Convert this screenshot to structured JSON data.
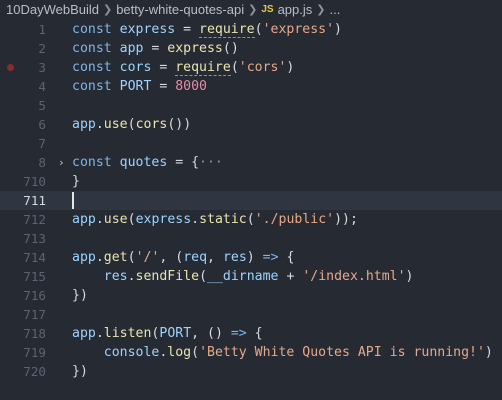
{
  "breadcrumb": {
    "items": [
      "10DayWebBuild",
      "betty-white-quotes-api"
    ],
    "file_icon": "JS",
    "file_name": "app.js",
    "trailing": "..."
  },
  "code_lines": [
    {
      "num": "1",
      "tokens": [
        [
          "kw",
          "const "
        ],
        [
          "id",
          "express"
        ],
        [
          "pn",
          " = "
        ],
        [
          "fn",
          "require"
        ],
        [
          "pn",
          "("
        ],
        [
          "str",
          "'express'"
        ],
        [
          "pn",
          ")"
        ]
      ]
    },
    {
      "num": "2",
      "tokens": [
        [
          "kw",
          "const "
        ],
        [
          "id",
          "app"
        ],
        [
          "pn",
          " = "
        ],
        [
          "fn",
          "express"
        ],
        [
          "pn",
          "()"
        ]
      ]
    },
    {
      "num": "3",
      "breakpoint": true,
      "tokens": [
        [
          "kw",
          "const "
        ],
        [
          "id",
          "cors"
        ],
        [
          "pn",
          " = "
        ],
        [
          "fn",
          "require"
        ],
        [
          "pn",
          "("
        ],
        [
          "str",
          "'cors'"
        ],
        [
          "pn",
          ")"
        ]
      ]
    },
    {
      "num": "4",
      "tokens": [
        [
          "kw",
          "const "
        ],
        [
          "id",
          "PORT"
        ],
        [
          "pn",
          " = "
        ],
        [
          "num",
          "8000"
        ]
      ]
    },
    {
      "num": "5",
      "tokens": []
    },
    {
      "num": "6",
      "tokens": [
        [
          "id",
          "app"
        ],
        [
          "pn",
          "."
        ],
        [
          "fn",
          "use"
        ],
        [
          "pn",
          "("
        ],
        [
          "fn",
          "cors"
        ],
        [
          "pn",
          "())"
        ]
      ]
    },
    {
      "num": "7",
      "tokens": []
    },
    {
      "num": "8",
      "fold": "›",
      "tokens": [
        [
          "kw",
          "const "
        ],
        [
          "id",
          "quotes"
        ],
        [
          "pn",
          " = {"
        ],
        [
          "dots",
          "···"
        ]
      ]
    },
    {
      "num": "710",
      "tokens": [
        [
          "pn",
          "}"
        ]
      ]
    },
    {
      "num": "711",
      "active": true,
      "cursor": true,
      "tokens": []
    },
    {
      "num": "712",
      "tokens": [
        [
          "id",
          "app"
        ],
        [
          "pn",
          "."
        ],
        [
          "fn",
          "use"
        ],
        [
          "pn",
          "("
        ],
        [
          "id",
          "express"
        ],
        [
          "pn",
          "."
        ],
        [
          "fn",
          "static"
        ],
        [
          "pn",
          "("
        ],
        [
          "str",
          "'./public'"
        ],
        [
          "pn",
          "));"
        ]
      ]
    },
    {
      "num": "713",
      "tokens": []
    },
    {
      "num": "714",
      "tokens": [
        [
          "id",
          "app"
        ],
        [
          "pn",
          "."
        ],
        [
          "fn",
          "get"
        ],
        [
          "pn",
          "("
        ],
        [
          "str",
          "'/'"
        ],
        [
          "pn",
          ", ("
        ],
        [
          "id",
          "req"
        ],
        [
          "pn",
          ", "
        ],
        [
          "id",
          "res"
        ],
        [
          "pn",
          ") "
        ],
        [
          "kw",
          "=>"
        ],
        [
          "pn",
          " {"
        ]
      ]
    },
    {
      "num": "715",
      "tokens": [
        [
          "pn",
          "    "
        ],
        [
          "id",
          "res"
        ],
        [
          "pn",
          "."
        ],
        [
          "fn",
          "sendFile"
        ],
        [
          "pn",
          "("
        ],
        [
          "id",
          "__dirname"
        ],
        [
          "pn",
          " + "
        ],
        [
          "str",
          "'/index.html'"
        ],
        [
          "pn",
          ")"
        ]
      ]
    },
    {
      "num": "716",
      "tokens": [
        [
          "pn",
          "})"
        ]
      ]
    },
    {
      "num": "717",
      "tokens": []
    },
    {
      "num": "718",
      "tokens": [
        [
          "id",
          "app"
        ],
        [
          "pn",
          "."
        ],
        [
          "fn",
          "listen"
        ],
        [
          "pn",
          "("
        ],
        [
          "id",
          "PORT"
        ],
        [
          "pn",
          ", () "
        ],
        [
          "kw",
          "=>"
        ],
        [
          "pn",
          " {"
        ]
      ]
    },
    {
      "num": "719",
      "tokens": [
        [
          "pn",
          "    "
        ],
        [
          "id",
          "console"
        ],
        [
          "pn",
          "."
        ],
        [
          "fn",
          "log"
        ],
        [
          "pn",
          "("
        ],
        [
          "str",
          "'Betty White Quotes API is running!'"
        ],
        [
          "pn",
          ")"
        ]
      ]
    },
    {
      "num": "720",
      "tokens": [
        [
          "pn",
          "})"
        ]
      ]
    }
  ]
}
